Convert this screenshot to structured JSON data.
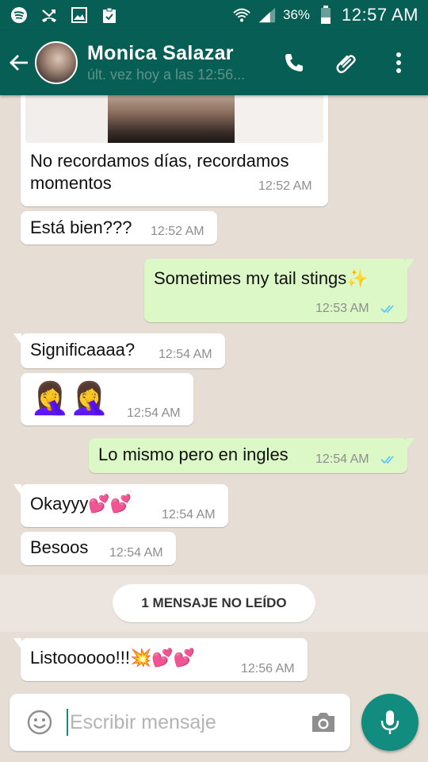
{
  "status_bar": {
    "battery_percent": "36%",
    "time": "12:57 AM",
    "icons": [
      "spotify-icon",
      "missed-call-icon",
      "image-icon",
      "clipboard-check-icon",
      "wifi-icon",
      "signal-icon",
      "battery-icon"
    ]
  },
  "header": {
    "contact_name": "Monica Salazar",
    "last_seen": "últ. vez hoy a las 12:56...",
    "actions": [
      "call-icon",
      "attach-icon",
      "more-icon"
    ]
  },
  "messages": [
    {
      "dir": "in",
      "text_line1": "No recordamos días, recordamos",
      "text_line2": "momentos",
      "time": "12:52 AM",
      "has_image": true
    },
    {
      "dir": "in",
      "text": "Está bien???",
      "time": "12:52 AM"
    },
    {
      "dir": "out",
      "text": "Sometimes my tail stings",
      "emoji": "✨",
      "time": "12:53 AM",
      "read": true
    },
    {
      "dir": "in",
      "text": "Significaaaa?",
      "time": "12:54 AM"
    },
    {
      "dir": "in",
      "emoji": "🤦‍♀️🤦‍♀️",
      "time": "12:54 AM"
    },
    {
      "dir": "out",
      "text": "Lo mismo pero en ingles",
      "time": "12:54 AM",
      "read": true
    },
    {
      "dir": "in",
      "text": "Okayyy",
      "emoji": "💕💕",
      "time": "12:54 AM"
    },
    {
      "dir": "in",
      "text": "Besoos",
      "time": "12:54 AM"
    },
    {
      "dir": "in",
      "text": "Listoooooo!!!",
      "emoji": "💥💕💕",
      "time": "12:56 AM"
    }
  ],
  "unread_banner": "1 MENSAJE NO LEÍDO",
  "composer": {
    "placeholder": "Escribir mensaje",
    "value": ""
  },
  "colors": {
    "header": "#075e54",
    "outgoing_bubble": "#dcf8c6",
    "incoming_bubble": "#ffffff",
    "chat_background": "#e6ddd4",
    "mic_button": "#128c7e",
    "read_ticks": "#4fc3f7"
  }
}
